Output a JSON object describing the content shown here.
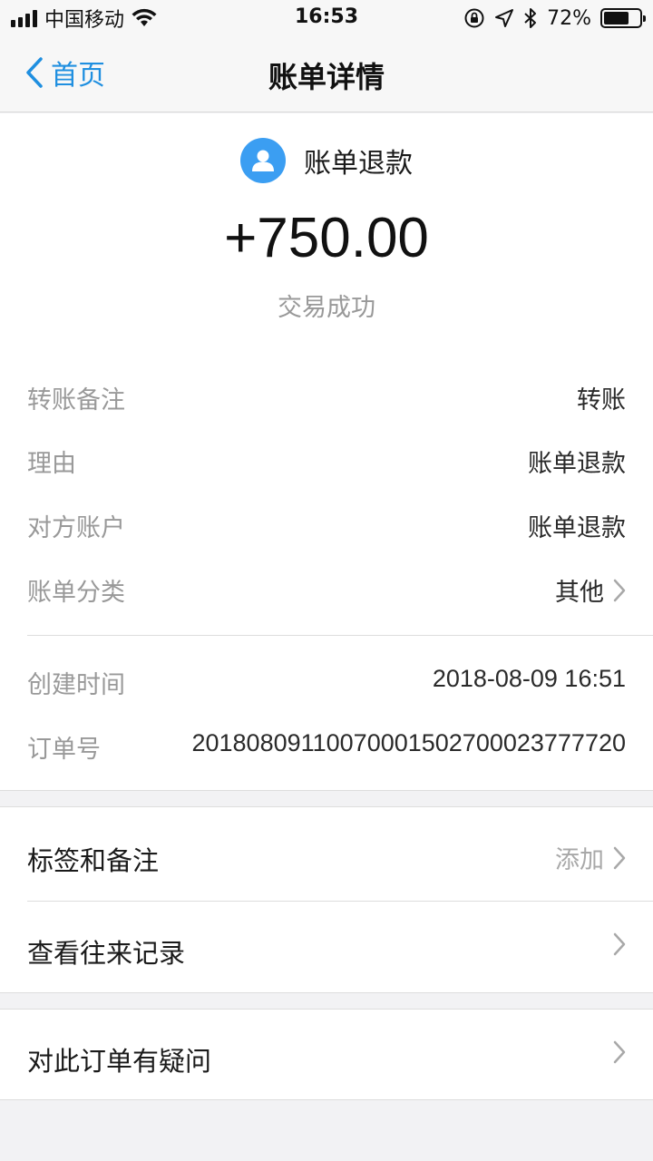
{
  "status_bar": {
    "carrier": "中国移动",
    "time": "16:53",
    "battery_percent": "72%",
    "battery_level": 0.72,
    "icons": [
      "signal-icon",
      "wifi-icon",
      "rotation-lock-icon",
      "location-icon",
      "bluetooth-icon",
      "battery-icon"
    ]
  },
  "nav": {
    "back_label": "首页",
    "title": "账单详情"
  },
  "bill": {
    "merchant": "账单退款",
    "amount": "+750.00",
    "status": "交易成功",
    "details": [
      {
        "label": "转账备注",
        "value": "转账"
      },
      {
        "label": "理由",
        "value": "账单退款"
      },
      {
        "label": "对方账户",
        "value": "账单退款"
      },
      {
        "label": "账单分类",
        "value": "其他"
      }
    ],
    "meta": [
      {
        "label": "创建时间",
        "value": "2018-08-09 16:51"
      },
      {
        "label": "订单号",
        "value": "20180809110070001502700023777720"
      }
    ]
  },
  "actions": {
    "tags_label": "标签和备注",
    "tags_action": "添加",
    "history_label": "查看往来记录",
    "question_label": "对此订单有疑问"
  },
  "colors": {
    "accent": "#1f8fe0",
    "avatar": "#3b9ef2",
    "background": "#f2f2f4"
  }
}
